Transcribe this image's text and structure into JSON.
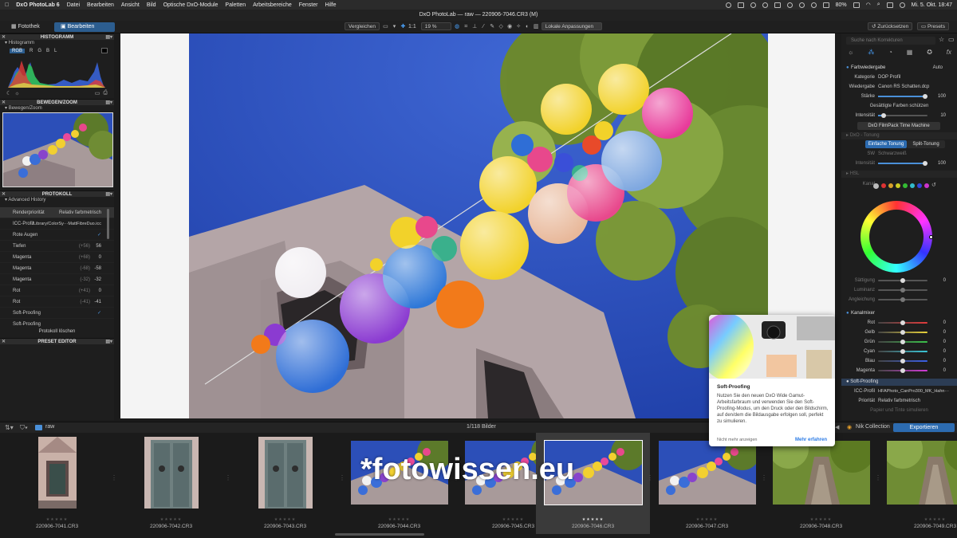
{
  "menubar": {
    "app": "DxO PhotoLab 6",
    "items": [
      "Datei",
      "Bearbeiten",
      "Ansicht",
      "Bild",
      "Optische DxO-Module",
      "Paletten",
      "Arbeitsbereiche",
      "Fenster",
      "Hilfe"
    ],
    "battery": "80%",
    "datetime": "Mi. 5. Okt. 18:47"
  },
  "window_title": "DxO PhotoLab — raw — 220906-7046.CR3 (M)",
  "toolbar": {
    "tab_library": "Fotothek",
    "tab_edit": "Bearbeiten",
    "compare": "Vergleichen",
    "zoom_fit": "1:1",
    "zoom_level": "19 %",
    "local_adjustments": "Lokale Anpassungen",
    "reset": "Zurücksetzen",
    "presets": "Presets"
  },
  "left_panel": {
    "histogram_title": "HISTOGRAMM",
    "histogram_sub": "Histogramm",
    "channels": [
      "RGB",
      "R",
      "G",
      "B",
      "L"
    ],
    "move_zoom_title": "BEWEGEN/ZOOM",
    "move_zoom_sub": "Bewegen/Zoom",
    "protocol_title": "PROTOKOLL",
    "advanced_history": "Advanced History",
    "history": [
      {
        "name": "Renderpriorität",
        "old": "",
        "val": "Relativ farbmetrisch"
      },
      {
        "name": "ICC-Profil",
        "old": "",
        "val": "/Library/ColorSy···MattFibreDuo.icc"
      },
      {
        "name": "Rote Augen",
        "old": "",
        "val": "✓"
      },
      {
        "name": "Tiefen",
        "old": "(+56)",
        "val": "56"
      },
      {
        "name": "Magenta",
        "old": "(+68)",
        "val": "0"
      },
      {
        "name": "Magenta",
        "old": "(-68)",
        "val": "-58"
      },
      {
        "name": "Magenta",
        "old": "(-32)",
        "val": "-32"
      },
      {
        "name": "Rot",
        "old": "(+41)",
        "val": "0"
      },
      {
        "name": "Rot",
        "old": "(-41)",
        "val": "-41"
      },
      {
        "name": "Soft-Proofing",
        "old": "",
        "val": "✓"
      },
      {
        "name": "Soft-Proofing",
        "old": "",
        "val": ""
      }
    ],
    "clear_history": "Protokoll löschen",
    "preset_editor": "PRESET EDITOR"
  },
  "right_panel": {
    "search_placeholder": "Suche nach Korrekturen",
    "color_rendering": "Farbwiedergabe",
    "auto": "Auto",
    "category_label": "Kategorie",
    "category_value": "DOP Profil",
    "rendering_label": "Wiedergabe",
    "rendering_value": "Canon RS Schatten.dcp",
    "strength_label": "Stärke",
    "strength_value": "100",
    "saturated_colors": "Gesättigte Farben schützen",
    "intensity_label": "Intensität",
    "intensity_value": "10",
    "filmpack": "DxO FilmPack Time Machine",
    "toning_head": "DxO - Tonung",
    "toning_simple": "Einfache Tonung",
    "toning_split": "Split-Tonung",
    "bw_label": "SW",
    "bw_value": "Schwarzweiß",
    "toning_intensity_label": "Intensität",
    "toning_intensity_value": "100",
    "hsl_head": "HSL",
    "channel_label": "Kanal",
    "saturation_label": "Sättigung",
    "saturation_value": "0",
    "luminance_label": "Luminanz",
    "equalization_label": "Angleichung",
    "channel_mixer": "Kanalmixer",
    "mixer": [
      {
        "name": "Rot",
        "value": "0",
        "color": "#e23b3b"
      },
      {
        "name": "Gelb",
        "value": "0",
        "color": "#e8d23a"
      },
      {
        "name": "Grün",
        "value": "0",
        "color": "#3bc24a"
      },
      {
        "name": "Cyan",
        "value": "0",
        "color": "#3ac8d8"
      },
      {
        "name": "Blau",
        "value": "0",
        "color": "#3a5fe8"
      },
      {
        "name": "Magenta",
        "value": "0",
        "color": "#d23ad8"
      }
    ],
    "soft_proofing": "Soft-Proofing",
    "icc_label": "ICC-Profil",
    "icc_value": "HFAPhoto_CanPro300_MK_Hahn···",
    "priority_label": "Priorität",
    "priority_value": "Relativ farbmetrisch",
    "paper_ink": "Papier und Tinte simulieren"
  },
  "popup": {
    "title": "Soft-Proofing",
    "text": "Nutzen Sie den neuen DxO Wide Gamut-Arbeitsfarbraum und verwenden Sie den Soft-Proofing-Modus, um den Druck oder den Bildschirm, auf den/dem die Bildausgabe erfolgen soll, perfekt zu simulieren.",
    "dismiss": "Nicht mehr anzeigen",
    "learn_more": "Mehr erfahren"
  },
  "filmstrip": {
    "folder": "raw",
    "count": "1/118 Bilder",
    "nik": "Nik Collection",
    "export": "Exportieren",
    "items": [
      {
        "name": "220906-7041.CR3",
        "stars": "★★★★★",
        "type": "church"
      },
      {
        "name": "220906-7042.CR3",
        "stars": "★★★★★",
        "type": "door"
      },
      {
        "name": "220906-7043.CR3",
        "stars": "★★★★★",
        "type": "door"
      },
      {
        "name": "220906-7044.CR3",
        "stars": "★★★★★",
        "type": "balloons"
      },
      {
        "name": "220906-7045.CR3",
        "stars": "★★★★★",
        "type": "balloons"
      },
      {
        "name": "220906-7046.CR3",
        "stars": "★★★★★",
        "type": "balloons"
      },
      {
        "name": "220906-7047.CR3",
        "stars": "★★★★★",
        "type": "balloons"
      },
      {
        "name": "220906-7048.CR3",
        "stars": "★★★★★",
        "type": "tree"
      },
      {
        "name": "220906-7049.CR3",
        "stars": "★★★★★",
        "type": "tree"
      }
    ]
  },
  "watermark": "*fotowissen.eu"
}
